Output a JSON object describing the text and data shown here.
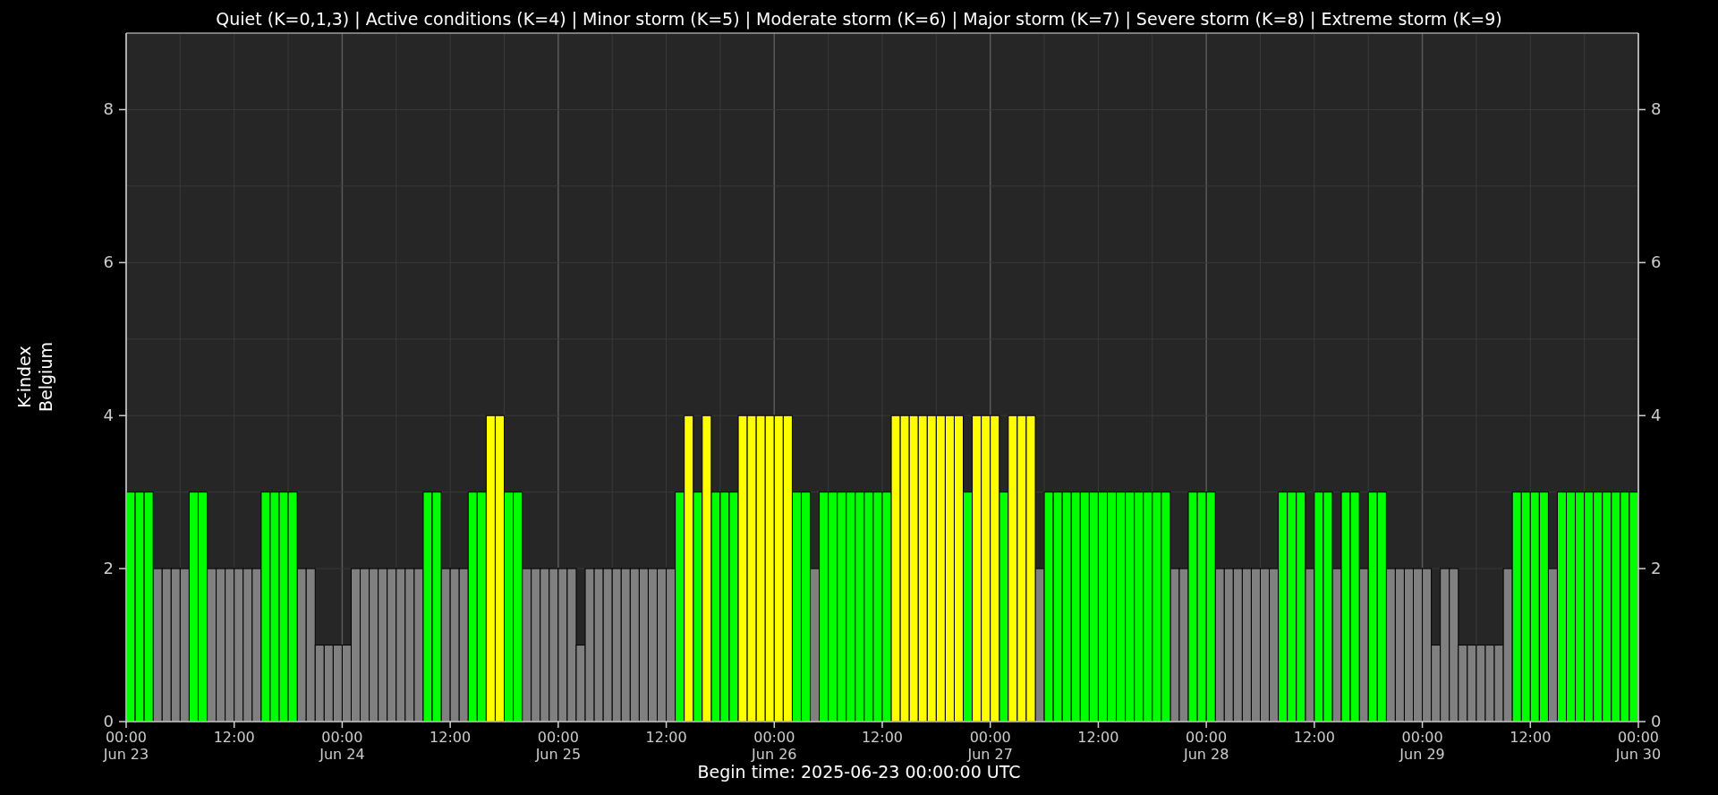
{
  "chart_data": {
    "type": "bar",
    "title": "Quiet (K=0,1,3) | Active conditions (K=4) | Minor storm (K=5) | Moderate storm (K=6) | Major storm (K=7) | Severe storm (K=8) | Extreme storm (K=9)",
    "xlabel": "Begin time: 2025-06-23 00:00:00 UTC",
    "ylabel": "K-index\nBelgium",
    "xlim": [
      "2025-06-23T00:00",
      "2025-06-30T00:00"
    ],
    "ylim": [
      0,
      9
    ],
    "y2lim": [
      0,
      9
    ],
    "grid": true,
    "yticks": [
      0,
      2,
      4,
      6,
      8
    ],
    "y2ticks": [
      0,
      2,
      4,
      6,
      8
    ],
    "xticks": [
      {
        "value": "2025-06-23T00:00",
        "label": "00:00\nJun 23"
      },
      {
        "value": "2025-06-23T12:00",
        "label": "12:00"
      },
      {
        "value": "2025-06-24T00:00",
        "label": "00:00\nJun 24"
      },
      {
        "value": "2025-06-24T12:00",
        "label": "12:00"
      },
      {
        "value": "2025-06-25T00:00",
        "label": "00:00\nJun 25"
      },
      {
        "value": "2025-06-25T12:00",
        "label": "12:00"
      },
      {
        "value": "2025-06-26T00:00",
        "label": "00:00\nJun 26"
      },
      {
        "value": "2025-06-26T12:00",
        "label": "12:00"
      },
      {
        "value": "2025-06-27T00:00",
        "label": "00:00\nJun 27"
      },
      {
        "value": "2025-06-27T12:00",
        "label": "12:00"
      },
      {
        "value": "2025-06-28T00:00",
        "label": "00:00\nJun 28"
      },
      {
        "value": "2025-06-28T12:00",
        "label": "12:00"
      },
      {
        "value": "2025-06-29T00:00",
        "label": "00:00\nJun 29"
      },
      {
        "value": "2025-06-29T12:00",
        "label": "12:00"
      },
      {
        "value": "2025-06-30T00:00",
        "label": "00:00\nJun 30"
      }
    ],
    "x": [
      "2025-06-23T00:00",
      "2025-06-23T01:00",
      "2025-06-23T02:00",
      "2025-06-23T03:00",
      "2025-06-23T04:00",
      "2025-06-23T05:00",
      "2025-06-23T06:00",
      "2025-06-23T07:00",
      "2025-06-23T08:00",
      "2025-06-23T09:00",
      "2025-06-23T10:00",
      "2025-06-23T11:00",
      "2025-06-23T12:00",
      "2025-06-23T13:00",
      "2025-06-23T14:00",
      "2025-06-23T15:00",
      "2025-06-23T16:00",
      "2025-06-23T17:00",
      "2025-06-23T18:00",
      "2025-06-23T19:00",
      "2025-06-23T20:00",
      "2025-06-23T21:00",
      "2025-06-23T22:00",
      "2025-06-23T23:00",
      "2025-06-24T00:00",
      "2025-06-24T01:00",
      "2025-06-24T02:00",
      "2025-06-24T03:00",
      "2025-06-24T04:00",
      "2025-06-24T05:00",
      "2025-06-24T06:00",
      "2025-06-24T07:00",
      "2025-06-24T08:00",
      "2025-06-24T09:00",
      "2025-06-24T10:00",
      "2025-06-24T11:00",
      "2025-06-24T12:00",
      "2025-06-24T13:00",
      "2025-06-24T14:00",
      "2025-06-24T15:00",
      "2025-06-24T16:00",
      "2025-06-24T17:00",
      "2025-06-24T18:00",
      "2025-06-24T19:00",
      "2025-06-24T20:00",
      "2025-06-24T21:00",
      "2025-06-24T22:00",
      "2025-06-24T23:00",
      "2025-06-25T00:00",
      "2025-06-25T01:00",
      "2025-06-25T02:00",
      "2025-06-25T03:00",
      "2025-06-25T04:00",
      "2025-06-25T05:00",
      "2025-06-25T06:00",
      "2025-06-25T07:00",
      "2025-06-25T08:00",
      "2025-06-25T09:00",
      "2025-06-25T10:00",
      "2025-06-25T11:00",
      "2025-06-25T12:00",
      "2025-06-25T13:00",
      "2025-06-25T14:00",
      "2025-06-25T15:00",
      "2025-06-25T16:00",
      "2025-06-25T17:00",
      "2025-06-25T18:00",
      "2025-06-25T19:00",
      "2025-06-25T20:00",
      "2025-06-25T21:00",
      "2025-06-25T22:00",
      "2025-06-25T23:00",
      "2025-06-26T00:00",
      "2025-06-26T01:00",
      "2025-06-26T02:00",
      "2025-06-26T03:00",
      "2025-06-26T04:00",
      "2025-06-26T05:00",
      "2025-06-26T06:00",
      "2025-06-26T07:00",
      "2025-06-26T08:00",
      "2025-06-26T09:00",
      "2025-06-26T10:00",
      "2025-06-26T11:00",
      "2025-06-26T12:00",
      "2025-06-26T13:00",
      "2025-06-26T14:00",
      "2025-06-26T15:00",
      "2025-06-26T16:00",
      "2025-06-26T17:00",
      "2025-06-26T18:00",
      "2025-06-26T19:00",
      "2025-06-26T20:00",
      "2025-06-26T21:00",
      "2025-06-26T22:00",
      "2025-06-26T23:00",
      "2025-06-27T00:00",
      "2025-06-27T01:00",
      "2025-06-27T02:00",
      "2025-06-27T03:00",
      "2025-06-27T04:00",
      "2025-06-27T05:00",
      "2025-06-27T06:00",
      "2025-06-27T07:00",
      "2025-06-27T08:00",
      "2025-06-27T09:00",
      "2025-06-27T10:00",
      "2025-06-27T11:00",
      "2025-06-27T12:00",
      "2025-06-27T13:00",
      "2025-06-27T14:00",
      "2025-06-27T15:00",
      "2025-06-27T16:00",
      "2025-06-27T17:00",
      "2025-06-27T18:00",
      "2025-06-27T19:00",
      "2025-06-27T20:00",
      "2025-06-27T21:00",
      "2025-06-27T22:00",
      "2025-06-27T23:00",
      "2025-06-28T00:00",
      "2025-06-28T01:00",
      "2025-06-28T02:00",
      "2025-06-28T03:00",
      "2025-06-28T04:00",
      "2025-06-28T05:00",
      "2025-06-28T06:00",
      "2025-06-28T07:00",
      "2025-06-28T08:00",
      "2025-06-28T09:00",
      "2025-06-28T10:00",
      "2025-06-28T11:00",
      "2025-06-28T12:00",
      "2025-06-28T13:00",
      "2025-06-28T14:00",
      "2025-06-28T15:00",
      "2025-06-28T16:00",
      "2025-06-28T17:00",
      "2025-06-28T18:00",
      "2025-06-28T19:00",
      "2025-06-28T20:00",
      "2025-06-28T21:00",
      "2025-06-28T22:00",
      "2025-06-28T23:00",
      "2025-06-29T00:00",
      "2025-06-29T01:00",
      "2025-06-29T02:00",
      "2025-06-29T03:00",
      "2025-06-29T04:00",
      "2025-06-29T05:00",
      "2025-06-29T06:00",
      "2025-06-29T07:00",
      "2025-06-29T08:00",
      "2025-06-29T09:00",
      "2025-06-29T10:00",
      "2025-06-29T11:00",
      "2025-06-29T12:00",
      "2025-06-29T13:00",
      "2025-06-29T14:00",
      "2025-06-29T15:00",
      "2025-06-29T16:00",
      "2025-06-29T17:00",
      "2025-06-29T18:00",
      "2025-06-29T19:00",
      "2025-06-29T20:00",
      "2025-06-29T21:00",
      "2025-06-29T22:00",
      "2025-06-29T23:00"
    ],
    "series": [
      {
        "color": "#808080",
        "values": [
          null,
          null,
          null,
          2,
          2,
          2,
          2,
          null,
          null,
          2,
          2,
          2,
          2,
          2,
          2,
          null,
          null,
          null,
          null,
          2,
          2,
          1,
          1,
          1,
          1,
          2,
          2,
          2,
          2,
          2,
          2,
          2,
          2,
          null,
          null,
          2,
          2,
          2,
          null,
          null,
          null,
          null,
          null,
          null,
          2,
          2,
          2,
          2,
          2,
          2,
          1,
          2,
          2,
          2,
          2,
          2,
          2,
          2,
          2,
          2,
          2,
          null,
          null,
          null,
          null,
          null,
          null,
          null,
          null,
          null,
          null,
          null,
          null,
          null,
          null,
          null,
          2,
          null,
          null,
          null,
          null,
          null,
          null,
          null,
          null,
          null,
          null,
          null,
          null,
          null,
          null,
          null,
          null,
          null,
          null,
          null,
          null,
          null,
          null,
          null,
          null,
          2,
          null,
          null,
          null,
          null,
          null,
          null,
          null,
          null,
          null,
          null,
          null,
          null,
          null,
          null,
          2,
          2,
          null,
          null,
          null,
          2,
          2,
          2,
          2,
          2,
          2,
          2,
          null,
          null,
          null,
          2,
          null,
          null,
          2,
          null,
          null,
          2,
          null,
          null,
          2,
          2,
          2,
          2,
          2,
          1,
          2,
          2,
          1,
          1,
          1,
          1,
          1,
          2,
          null,
          null,
          null,
          null,
          2,
          null,
          null,
          null,
          null,
          null,
          null,
          null,
          null,
          null
        ]
      },
      {
        "color": "#00ff00",
        "values": [
          3,
          3,
          3,
          null,
          null,
          null,
          null,
          3,
          3,
          null,
          null,
          null,
          null,
          null,
          null,
          3,
          3,
          3,
          3,
          null,
          null,
          null,
          null,
          null,
          null,
          null,
          null,
          null,
          null,
          null,
          null,
          null,
          null,
          3,
          3,
          null,
          null,
          null,
          3,
          3,
          null,
          null,
          3,
          3,
          null,
          null,
          null,
          null,
          null,
          null,
          null,
          null,
          null,
          null,
          null,
          null,
          null,
          null,
          null,
          null,
          null,
          3,
          null,
          3,
          null,
          3,
          3,
          3,
          null,
          null,
          null,
          null,
          null,
          null,
          3,
          3,
          null,
          3,
          3,
          3,
          3,
          3,
          3,
          3,
          3,
          null,
          null,
          null,
          null,
          null,
          null,
          null,
          null,
          3,
          null,
          null,
          null,
          3,
          null,
          null,
          null,
          null,
          3,
          3,
          3,
          3,
          3,
          3,
          3,
          3,
          3,
          3,
          3,
          3,
          3,
          3,
          null,
          null,
          3,
          3,
          3,
          null,
          null,
          null,
          null,
          null,
          null,
          null,
          3,
          3,
          3,
          null,
          3,
          3,
          null,
          3,
          3,
          null,
          3,
          3,
          null,
          null,
          null,
          null,
          null,
          null,
          null,
          null,
          null,
          null,
          null,
          null,
          null,
          null,
          3,
          3,
          3,
          3,
          null,
          3,
          3,
          3,
          3,
          3,
          3,
          3,
          3,
          3
        ]
      },
      {
        "color": "#ffff00",
        "values": [
          null,
          null,
          null,
          null,
          null,
          null,
          null,
          null,
          null,
          null,
          null,
          null,
          null,
          null,
          null,
          null,
          null,
          null,
          null,
          null,
          null,
          null,
          null,
          null,
          null,
          null,
          null,
          null,
          null,
          null,
          null,
          null,
          null,
          null,
          null,
          null,
          null,
          null,
          null,
          null,
          4,
          4,
          null,
          null,
          null,
          null,
          null,
          null,
          null,
          null,
          null,
          null,
          null,
          null,
          null,
          null,
          null,
          null,
          null,
          null,
          null,
          null,
          4,
          null,
          4,
          null,
          null,
          null,
          4,
          4,
          4,
          4,
          4,
          4,
          null,
          null,
          null,
          null,
          null,
          null,
          null,
          null,
          null,
          null,
          null,
          4,
          4,
          4,
          4,
          4,
          4,
          4,
          4,
          null,
          4,
          4,
          4,
          null,
          4,
          4,
          4,
          null,
          null,
          null,
          null,
          null,
          null,
          null,
          null,
          null,
          null,
          null,
          null,
          null,
          null,
          null,
          null,
          null,
          null,
          null,
          null,
          null,
          null,
          null,
          null,
          null,
          null,
          null,
          null,
          null,
          null,
          null,
          null,
          null,
          null,
          null,
          null,
          null,
          null,
          null,
          null,
          null,
          null,
          null,
          null,
          null,
          null,
          null,
          null,
          null,
          null,
          null,
          null,
          null,
          null,
          null,
          null,
          null,
          null,
          null,
          null,
          null,
          null,
          null,
          null,
          null,
          null,
          null
        ]
      }
    ]
  }
}
